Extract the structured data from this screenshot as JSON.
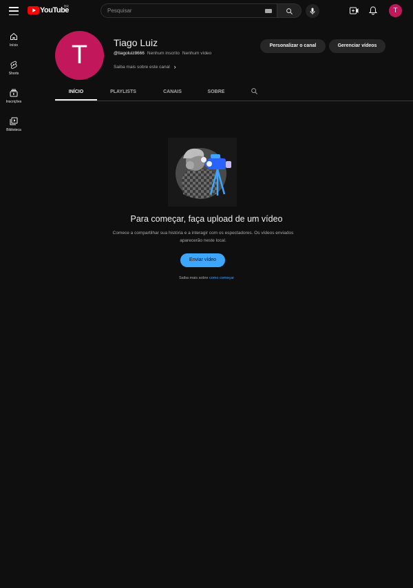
{
  "header": {
    "logo_text": "YouTube",
    "region": "BR",
    "search_placeholder": "Pesquisar",
    "avatar_letter": "T"
  },
  "sidebar": {
    "items": [
      {
        "label": "Início",
        "icon": "home-icon"
      },
      {
        "label": "Shorts",
        "icon": "shorts-icon"
      },
      {
        "label": "Inscrições",
        "icon": "subscriptions-icon"
      },
      {
        "label": "Biblioteca",
        "icon": "library-icon"
      }
    ]
  },
  "channel": {
    "avatar_letter": "T",
    "name": "Tiago Luiz",
    "handle": "@tiagoluiz8666",
    "subscribers": "Nenhum inscrito",
    "videos": "Nenhum vídeo",
    "about_link": "Saiba mais sobre este canal",
    "customize_button": "Personalizar o canal",
    "manage_button": "Gerenciar vídeos"
  },
  "tabs": [
    {
      "label": "INÍCIO",
      "active": true
    },
    {
      "label": "PLAYLISTS",
      "active": false
    },
    {
      "label": "CANAIS",
      "active": false
    },
    {
      "label": "SOBRE",
      "active": false
    }
  ],
  "empty_state": {
    "title": "Para começar, faça upload de um vídeo",
    "description": "Comece a compartilhar sua história e a interagir com os espectadores. Os vídeos enviados aparecerão neste local.",
    "upload_button": "Enviar vídeo",
    "learn_prefix": "Saiba mais sobre",
    "learn_link": "como começar"
  },
  "colors": {
    "background": "#0f0f0f",
    "avatar": "#c2185b",
    "accent": "#3ea6ff",
    "brand_red": "#ff0000"
  }
}
